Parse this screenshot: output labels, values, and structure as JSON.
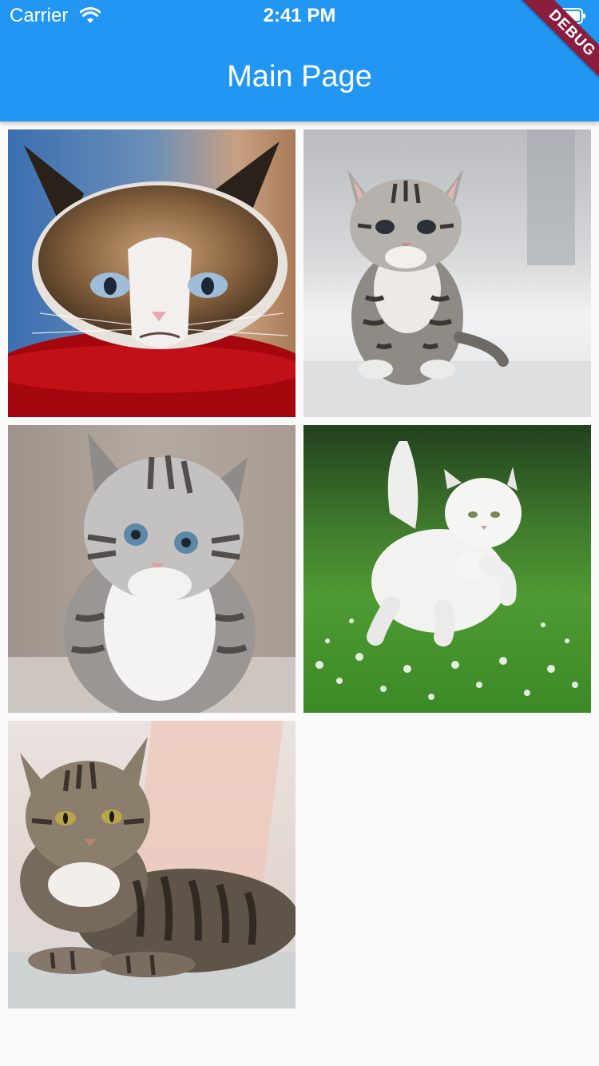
{
  "status_bar": {
    "carrier": "Carrier",
    "time": "2:41 PM",
    "wifi_icon": "wifi-icon",
    "battery_icon": "battery-icon"
  },
  "app_bar": {
    "title": "Main Page",
    "color": "#2196f3"
  },
  "debug_banner": {
    "label": "DEBUG",
    "color": "#8b1e3f"
  },
  "gallery": {
    "images": [
      {
        "name": "grumpy-cat-photo"
      },
      {
        "name": "tabby-kitten-standing-photo"
      },
      {
        "name": "fluffy-kitten-photo"
      },
      {
        "name": "white-cat-in-grass-photo"
      },
      {
        "name": "tabby-cat-lying-photo"
      }
    ]
  }
}
